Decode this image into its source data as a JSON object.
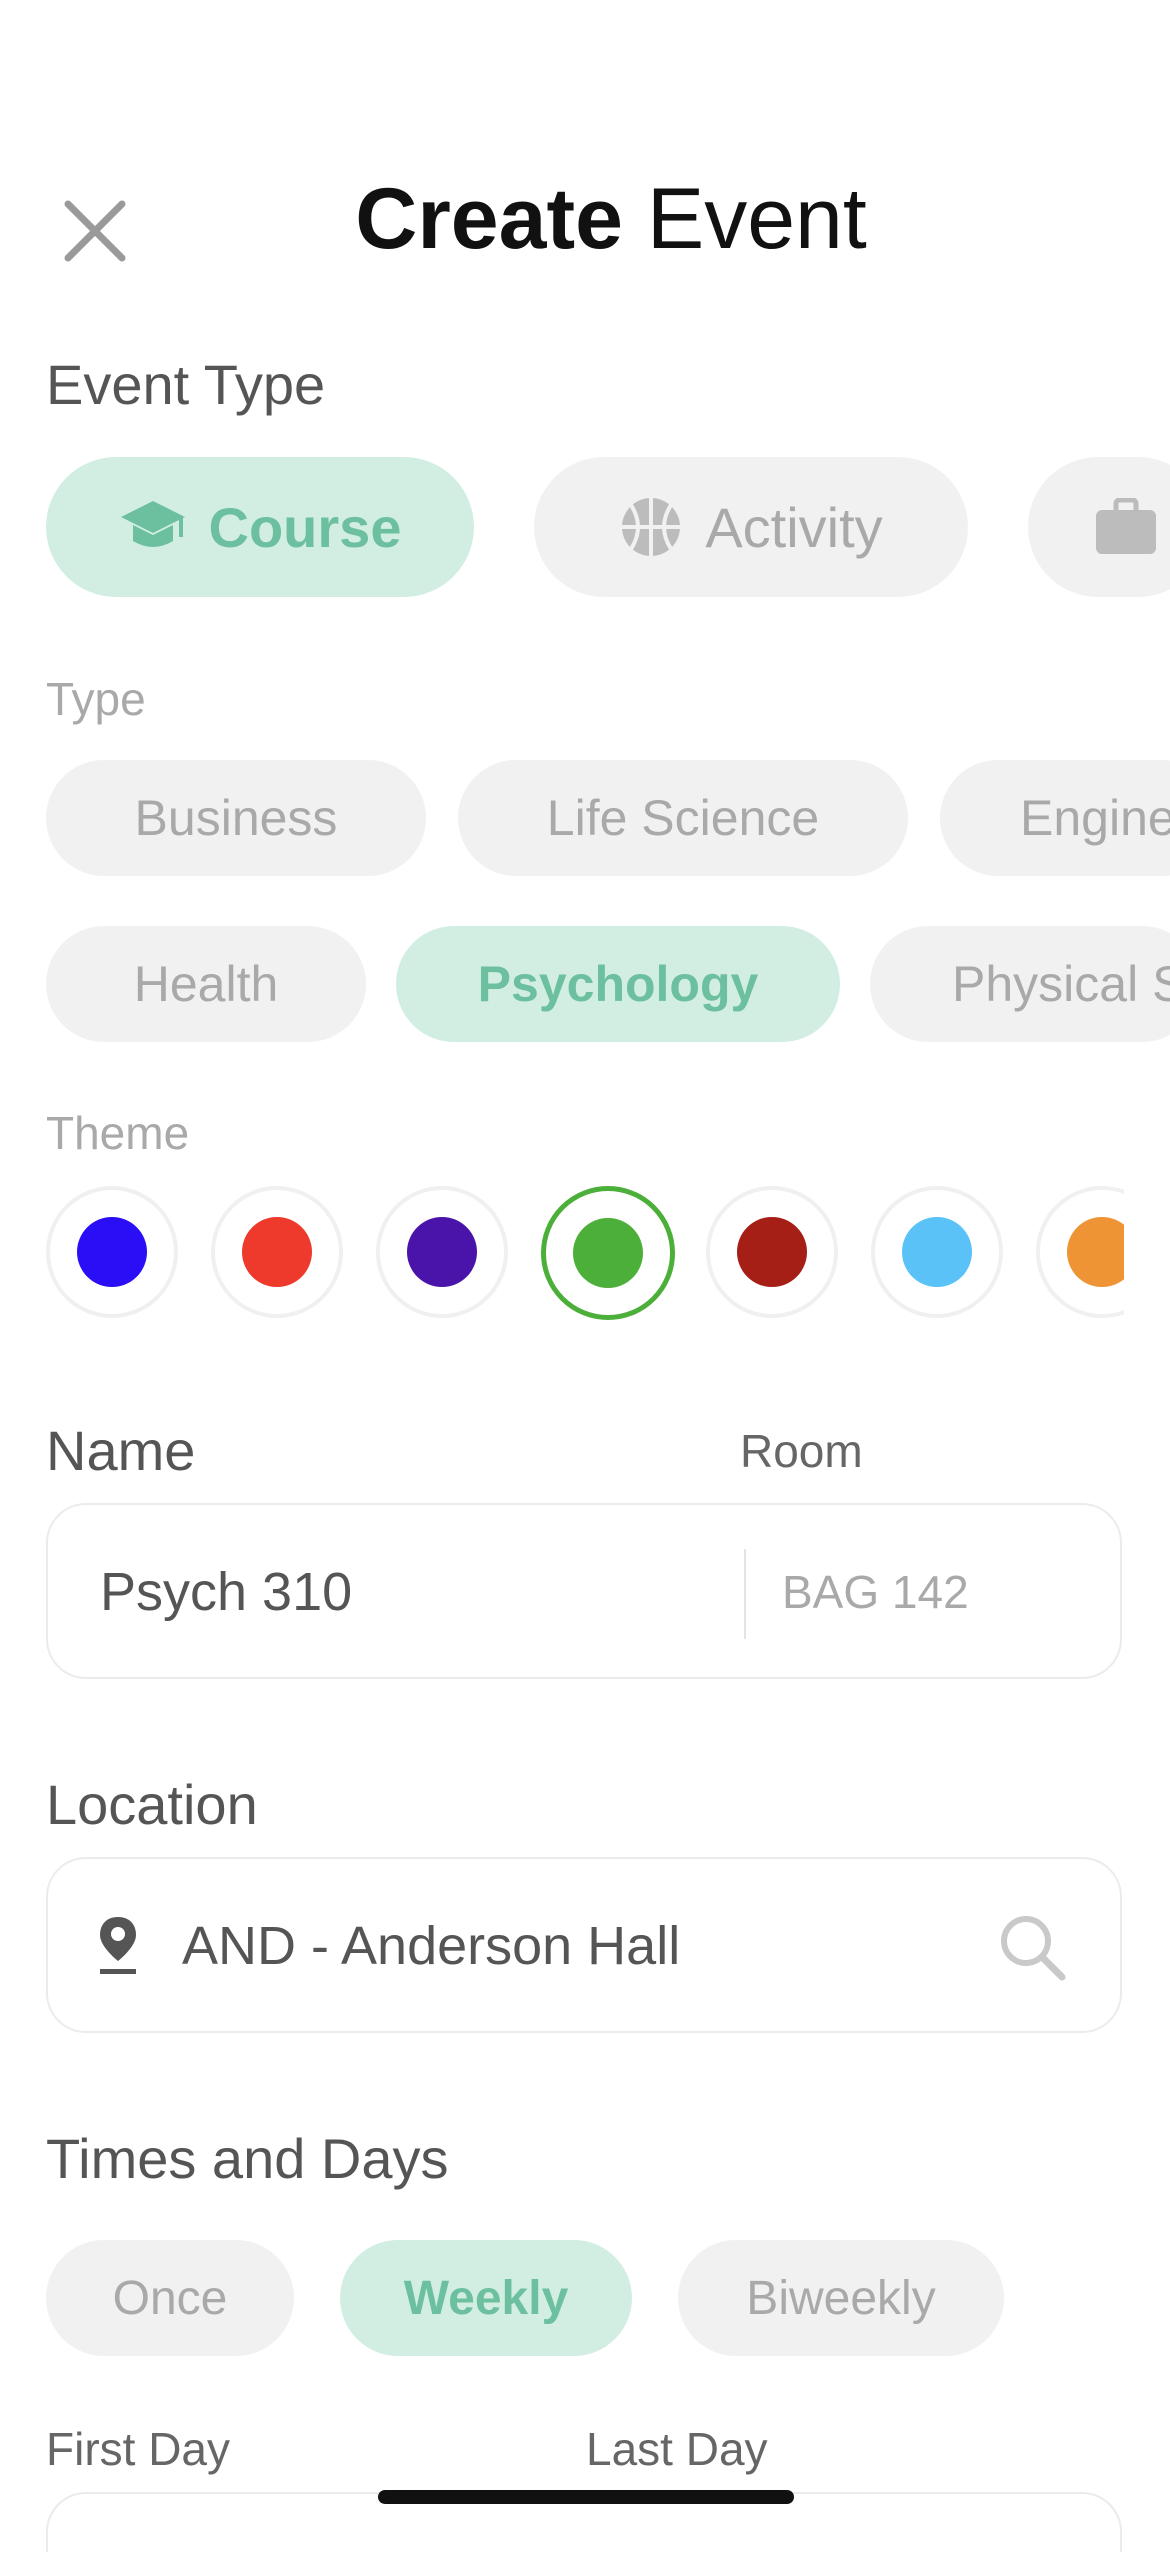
{
  "header": {
    "title_bold": "Create",
    "title_regular": "Event"
  },
  "event_type": {
    "label": "Event Type",
    "options": [
      {
        "label": "Course",
        "icon": "graduation-cap-icon",
        "selected": true
      },
      {
        "label": "Activity",
        "icon": "basketball-icon",
        "selected": false
      },
      {
        "label": "",
        "icon": "briefcase-icon",
        "selected": false
      }
    ]
  },
  "type": {
    "label": "Type",
    "row1": [
      {
        "label": "Business",
        "selected": false
      },
      {
        "label": "Life Science",
        "selected": false
      },
      {
        "label": "Engine",
        "selected": false
      }
    ],
    "row2": [
      {
        "label": "Health",
        "selected": false
      },
      {
        "label": "Psychology",
        "selected": true
      },
      {
        "label": "Physical S",
        "selected": false
      }
    ]
  },
  "theme": {
    "label": "Theme",
    "colors": [
      "#2a0ef5",
      "#ee3a2c",
      "#4a14aa",
      "#4caf3a",
      "#a61f16",
      "#5ac2f7",
      "#ef9434"
    ],
    "selected_index": 3
  },
  "name": {
    "label": "Name",
    "value": "Psych 310"
  },
  "room": {
    "label": "Room",
    "placeholder": "BAG 142"
  },
  "location": {
    "label": "Location",
    "value": "AND - Anderson Hall"
  },
  "times_days": {
    "label": "Times and Days",
    "options": [
      {
        "label": "Once",
        "selected": false
      },
      {
        "label": "Weekly",
        "selected": true
      },
      {
        "label": "Biweekly",
        "selected": false
      }
    ]
  },
  "first_day": {
    "label": "First Day"
  },
  "last_day": {
    "label": "Last Day"
  },
  "accent_color": "#6cc09f",
  "accent_bg": "#d2eee2"
}
